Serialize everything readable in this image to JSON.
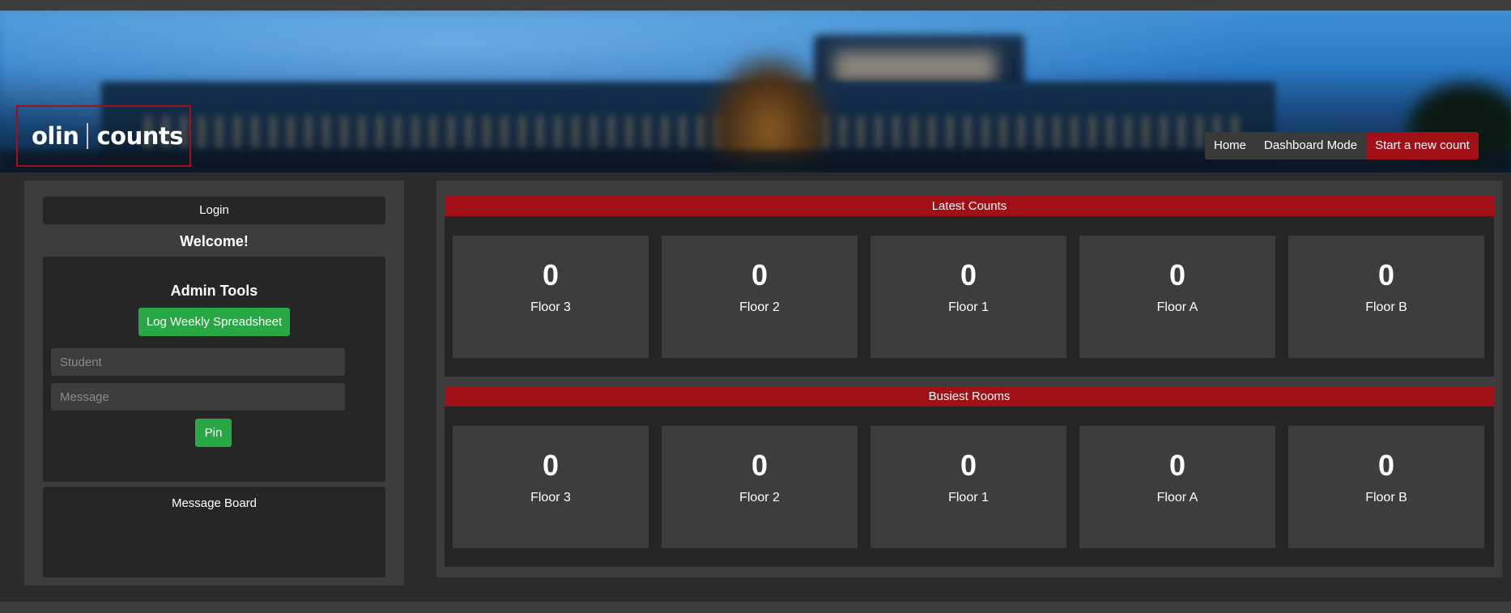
{
  "header": {
    "logo": {
      "word1": "olin",
      "word2": "counts",
      "border_color": "#a01016"
    },
    "nav": [
      {
        "label": "Home"
      },
      {
        "label": "Dashboard Mode"
      },
      {
        "label": "Start a new count"
      }
    ]
  },
  "sidebar": {
    "login_label": "Login",
    "welcome": "Welcome!",
    "admin": {
      "title": "Admin Tools",
      "log_button": "Log Weekly Spreadsheet",
      "student_placeholder": "Student",
      "message_placeholder": "Message",
      "pin_button": "Pin"
    },
    "message_board": {
      "title": "Message Board"
    }
  },
  "main": {
    "latest_counts": {
      "title": "Latest Counts",
      "cards": [
        {
          "value": "0",
          "label": "Floor 3"
        },
        {
          "value": "0",
          "label": "Floor 2"
        },
        {
          "value": "0",
          "label": "Floor 1"
        },
        {
          "value": "0",
          "label": "Floor A"
        },
        {
          "value": "0",
          "label": "Floor B"
        }
      ]
    },
    "busiest_rooms": {
      "title": "Busiest Rooms",
      "cards": [
        {
          "value": "0",
          "label": "Floor 3"
        },
        {
          "value": "0",
          "label": "Floor 2"
        },
        {
          "value": "0",
          "label": "Floor 1"
        },
        {
          "value": "0",
          "label": "Floor A"
        },
        {
          "value": "0",
          "label": "Floor B"
        }
      ]
    }
  },
  "colors": {
    "accent_red": "#a01016",
    "button_green": "#28a745",
    "panel": "#3d3d3d",
    "inner": "#262626"
  }
}
